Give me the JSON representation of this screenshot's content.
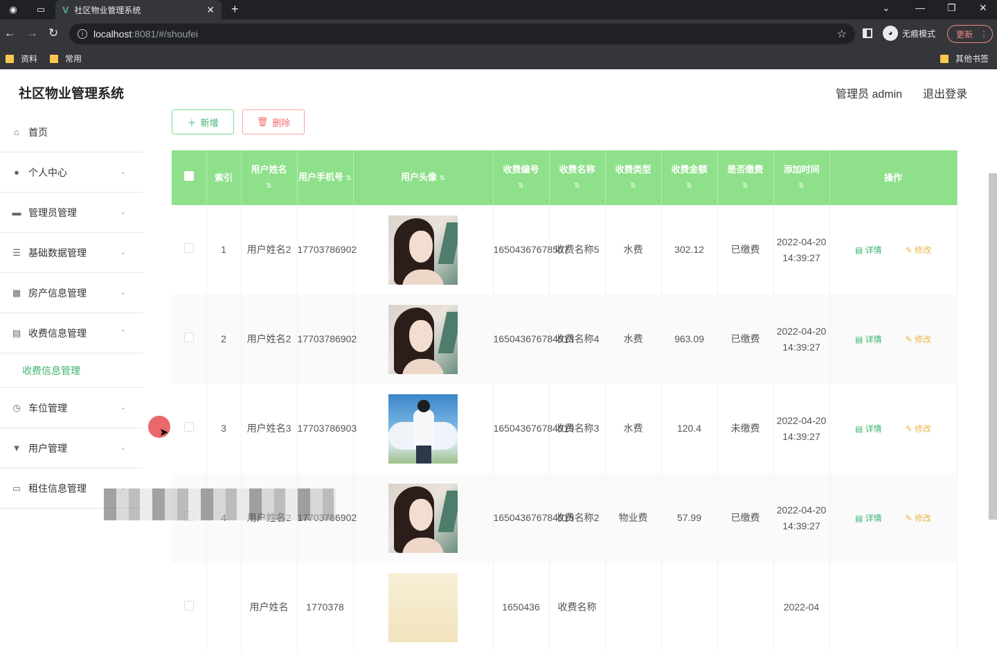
{
  "browser": {
    "tab_title": "社区物业管理系统",
    "address_host": "localhost",
    "address_path": ":8081/#/shoufei",
    "incognito_label": "无痕模式",
    "update_label": "更新",
    "bookmarks": [
      "资料",
      "常用"
    ],
    "other_bookmarks": "其他书签"
  },
  "header": {
    "system_name": "社区物业管理系统",
    "user_info": "管理员 admin",
    "logout_label": "退出登录"
  },
  "sidebar": {
    "items": [
      {
        "label": "首页",
        "icon": "home-icon"
      },
      {
        "label": "个人中心",
        "icon": "user-icon"
      },
      {
        "label": "管理员管理",
        "icon": "id-card-icon"
      },
      {
        "label": "基础数据管理",
        "icon": "list-icon"
      },
      {
        "label": "房产信息管理",
        "icon": "grid-icon"
      },
      {
        "label": "收费信息管理",
        "icon": "clipboard-icon"
      },
      {
        "label": "车位管理",
        "icon": "clock-icon"
      },
      {
        "label": "用户管理",
        "icon": "pin-icon"
      },
      {
        "label": "租住信息管理",
        "icon": "monitor-icon"
      }
    ],
    "active_sub": "收费信息管理"
  },
  "toolbar": {
    "add_label": "新增",
    "delete_label": "删除"
  },
  "table": {
    "headers": [
      "索引",
      "用户姓名",
      "用户手机号",
      "用户头像",
      "收费编号",
      "收费名称",
      "收费类型",
      "收费金额",
      "是否缴费",
      "添加时间",
      "操作"
    ],
    "detail_label": "详情",
    "edit_label": "修改",
    "rows": [
      {
        "index": "1",
        "name": "用户姓名2",
        "phone": "17703786902",
        "avatar": "girl",
        "fee_no": "16504367678507",
        "fee_name": "收费名称5",
        "fee_type": "水费",
        "amount": "302.12",
        "paid": "已缴费",
        "time": "2022-04-20 14:39:27"
      },
      {
        "index": "2",
        "name": "用户姓名2",
        "phone": "17703786902",
        "avatar": "girl",
        "fee_no": "165043676784913",
        "fee_name": "收费名称4",
        "fee_type": "水费",
        "amount": "963.09",
        "paid": "已缴费",
        "time": "2022-04-20 14:39:27"
      },
      {
        "index": "3",
        "name": "用户姓名3",
        "phone": "17703786903",
        "avatar": "boy",
        "fee_no": "165043676784919",
        "fee_name": "收费名称3",
        "fee_type": "水费",
        "amount": "120.4",
        "paid": "未缴费",
        "time": "2022-04-20 14:39:27"
      },
      {
        "index": "4",
        "name": "用户姓名2",
        "phone": "17703786902",
        "avatar": "girl",
        "fee_no": "165043676784915",
        "fee_name": "收费名称2",
        "fee_type": "物业费",
        "amount": "57.99",
        "paid": "已缴费",
        "time": "2022-04-20 14:39:27"
      },
      {
        "index": "",
        "name": "用户姓名",
        "phone": "1770378",
        "avatar": "blonde",
        "fee_no": "1650436",
        "fee_name": "收费名称",
        "fee_type": "",
        "amount": "",
        "paid": "",
        "time": "2022-04"
      }
    ]
  }
}
